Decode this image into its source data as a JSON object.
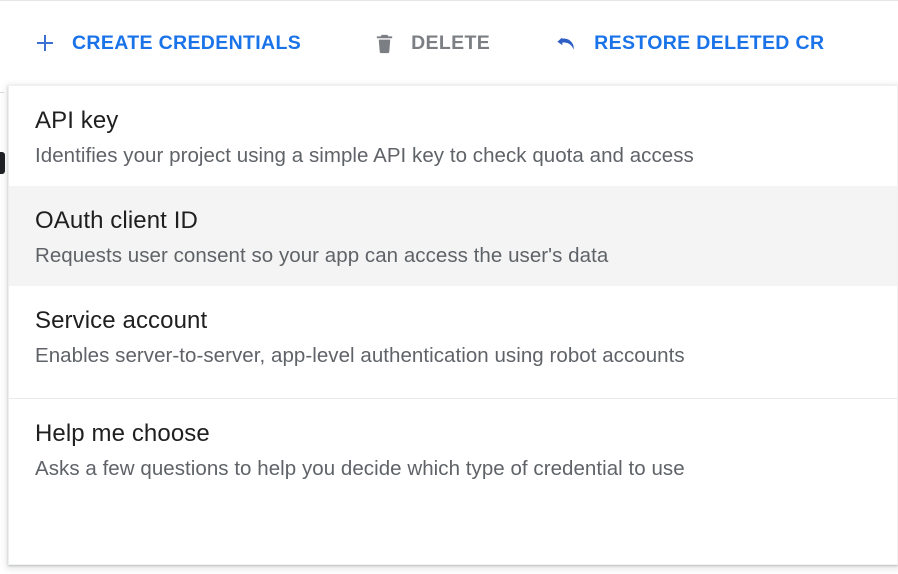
{
  "toolbar": {
    "create_credentials_label": "CREATE CREDENTIALS",
    "create_credentials_icon": "plus-icon",
    "delete_label": "DELETE",
    "delete_icon": "trash-icon",
    "restore_label": "RESTORE DELETED CR",
    "restore_icon": "undo-arrow-icon"
  },
  "menu": {
    "items": [
      {
        "title": "API key",
        "description": "Identifies your project using a simple API key to check quota and access",
        "highlighted": false
      },
      {
        "title": "OAuth client ID",
        "description": "Requests user consent so your app can access the user's data",
        "highlighted": true
      },
      {
        "title": "Service account",
        "description": "Enables server-to-server, app-level authentication using robot accounts",
        "highlighted": false
      },
      {
        "title": "Help me choose",
        "description": "Asks a few questions to help you decide which type of credential to use",
        "highlighted": false
      }
    ]
  },
  "colors": {
    "accent_blue": "#1a73e8",
    "disabled_gray": "#7b7f83",
    "title_text": "#1f1f1f",
    "desc_text": "#5f6368",
    "highlight_bg": "#f4f4f4",
    "panel_bg": "#ffffff"
  }
}
